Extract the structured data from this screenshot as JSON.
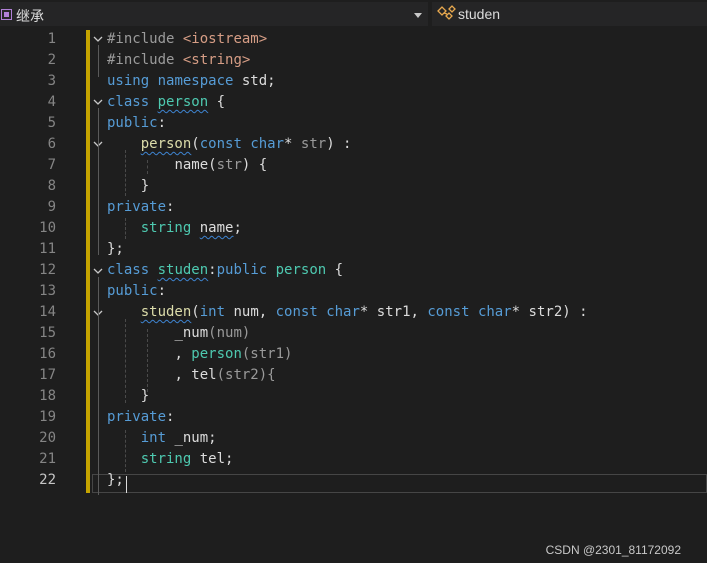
{
  "nav": {
    "scope": "继承",
    "symbol": "studen"
  },
  "editor": {
    "line_numbers": [
      "1",
      "2",
      "3",
      "4",
      "5",
      "6",
      "7",
      "8",
      "9",
      "10",
      "11",
      "12",
      "13",
      "14",
      "15",
      "16",
      "17",
      "18",
      "19",
      "20",
      "21",
      "22"
    ],
    "active_line": "22"
  },
  "watermark": "CSDN @2301_81172092",
  "colors": {
    "keyword": "#569cd6",
    "string": "#d69d85",
    "preprocessor": "#9b9b9b",
    "type": "#4ec9b0",
    "function": "#dcdcaa",
    "plain": "#dcdcdc",
    "change_bar": "#c5a400"
  },
  "code": {
    "l1": {
      "a": "#include",
      "b": " ",
      "c": "<iostream>"
    },
    "l2": {
      "a": "#include",
      "b": " ",
      "c": "<string>"
    },
    "l3": {
      "a": "using",
      "b": " ",
      "c": "namespace",
      "d": " std;"
    },
    "l4": {
      "a": "class",
      "b": " ",
      "c": "person",
      "d": " {"
    },
    "l5": {
      "a": "public",
      "b": ":"
    },
    "l6": {
      "i": "    ",
      "a": "person",
      "b": "(",
      "c": "const",
      "d": " ",
      "e": "char",
      "f": "* ",
      "g": "str",
      "h": ") :"
    },
    "l7": {
      "i": "        ",
      "a": "name",
      "b": "(",
      "c": "str",
      "d": ") {"
    },
    "l8": {
      "i": "    ",
      "a": "}"
    },
    "l9": {
      "a": "private",
      "b": ":"
    },
    "l10": {
      "i": "    ",
      "a": "string",
      "b": " ",
      "c": "name",
      "d": ";"
    },
    "l11": {
      "a": "};"
    },
    "l12": {
      "a": "class",
      "b": " ",
      "c": "studen",
      "d": ":",
      "e": "public",
      "f": " ",
      "g": "person",
      "h": " {"
    },
    "l13": {
      "a": "public",
      "b": ":"
    },
    "l14": {
      "i": "    ",
      "a": "studen",
      "b": "(",
      "c": "int",
      "d": " num, ",
      "e": "const",
      "f": " ",
      "g": "char",
      "h": "* str1, ",
      "j": "const",
      "k": " ",
      "l": "char",
      "m": "* str2) :"
    },
    "l15": {
      "i": "        ",
      "a": "_num",
      "b": "(num)"
    },
    "l16": {
      "i": "        ",
      "a": ", ",
      "b": "person",
      "c": "(str1)"
    },
    "l17": {
      "i": "        ",
      "a": ", ",
      "b": "tel",
      "c": "(str2){"
    },
    "l18": {
      "i": "    ",
      "a": "}"
    },
    "l19": {
      "a": "private",
      "b": ":"
    },
    "l20": {
      "i": "    ",
      "a": "int",
      "b": " _num;"
    },
    "l21": {
      "i": "    ",
      "a": "string",
      "b": " tel;"
    },
    "l22": {
      "a": "};"
    }
  }
}
